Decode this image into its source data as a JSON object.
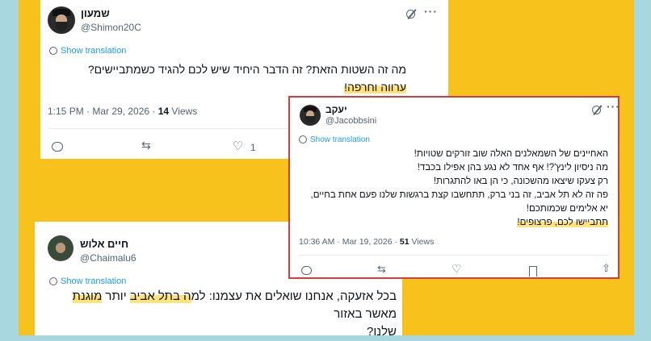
{
  "tweet1": {
    "name": "שמעון",
    "handle": "@Shimon20C",
    "translate_label": "Show translation",
    "line1": "מה זה השטות הזאת? זה הדבר היחיד שיש לכם להגיד כשמתביישים?",
    "line2": "ערווה וחרפה!",
    "time": "1:15 PM · Mar 29, 2026 · ",
    "views_count": "14",
    "views_label": " Views",
    "like_count": "1"
  },
  "tweet2": {
    "name": "חיים אלוש",
    "handle": "@Chaimalu6",
    "translate_label": "Show translation",
    "line1_part1": "בכל אזעקה, אנחנו שואלים את עצמנו: למ",
    "line1_highlight1": "ה בתל אביב",
    "line1_part2": " יותר ",
    "line1_highlight2": "מוגנת",
    "line1_part3": " מאשר באזור",
    "line2": "שלנו?"
  },
  "tweet3": {
    "name": "יעקב",
    "handle": "@Jacobbsini",
    "translate_label": "Show translation",
    "lines": [
      "האחיינים של השמאלנים האלה שוב זורקים שטויות!",
      "מה ניסיון לינץ'?! אף אחד לא נגע בהן אפילו בכבד!",
      "רק צעקו שיצאו מהשכונה, כי הן באו להתגרות!",
      "פה זה לא תל אביב, זה בני ברק, תתחשבו קצת ברגשות שלנו פעם אחת בחיים,",
      "יא אלימים שכמותכם!"
    ],
    "last_line": "תתביישו לכם, פרצופים!",
    "time": "10:36 AM · Mar 19, 2026 · ",
    "views_count": "51",
    "views_label": " Views"
  }
}
